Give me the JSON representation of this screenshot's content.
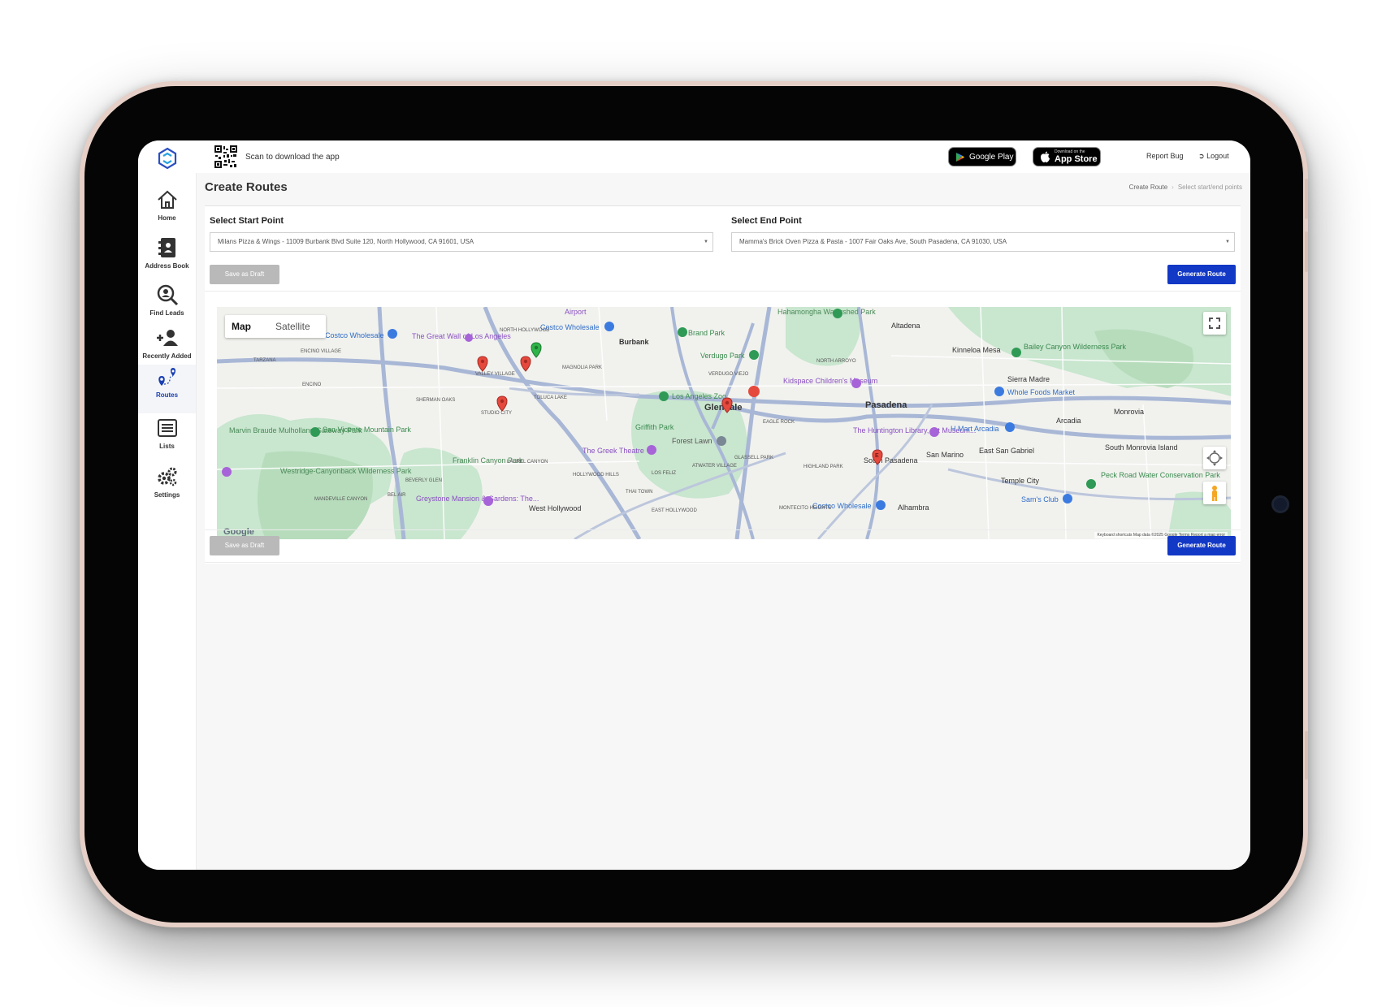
{
  "app": {
    "download": {
      "text": "Scan to download the app"
    },
    "stores": {
      "google_play": "Google Play",
      "app_store_small": "Download on the",
      "app_store": "App Store"
    },
    "top_links": {
      "report_bug": "Report Bug",
      "logout": "Logout"
    }
  },
  "sidebar": {
    "items": [
      {
        "label": "Home",
        "icon": "home-icon"
      },
      {
        "label": "Address Book",
        "icon": "address-book-icon"
      },
      {
        "label": "Find Leads",
        "icon": "search-person-icon"
      },
      {
        "label": "Recently Added",
        "icon": "add-user-icon"
      },
      {
        "label": "Routes",
        "icon": "route-pins-icon",
        "active": true
      },
      {
        "label": "Lists",
        "icon": "list-icon"
      },
      {
        "label": "Settings",
        "icon": "gears-icon"
      }
    ]
  },
  "page": {
    "title": "Create Routes",
    "breadcrumb": [
      "Create Route",
      "Select start/end points"
    ]
  },
  "form": {
    "start_label": "Select Start Point",
    "start_value": "Milans Pizza & Wings - 11009 Burbank Blvd Suite 120, North Hollywood, CA 91601, USA",
    "end_label": "Select End Point",
    "end_value": "Mamma's Brick Oven Pizza & Pasta - 1007 Fair Oaks Ave, South Pasadena, CA 91030, USA",
    "save_draft": "Save as Draft",
    "generate": "Generate Route"
  },
  "map": {
    "type_options": [
      "Map",
      "Satellite"
    ],
    "selected_type": "Map",
    "labels": [
      "Airport",
      "Costco Wholesale",
      "Burbank",
      "Hahamongha Watershed Park",
      "Altadena",
      "Brand Park",
      "Verdugo Park",
      "The Great Wall of Los Angeles",
      "Costco Wholesale",
      "NORTH HOLLYWOOD",
      "ENCINO VILLAGE",
      "TARZANA",
      "VALLEY VILLAGE",
      "MAGNOLIA PARK",
      "VERDUGO VIEJO",
      "NORTH ARROYO",
      "Kinneloa Mesa",
      "Bailey Canyon Wilderness Park",
      "Sierra Madre",
      "Whole Foods Market",
      "ENCINO",
      "SHERMAN OAKS",
      "TOLUCA LAKE",
      "Los Angeles Zoo",
      "Glendale",
      "Kidspace Children's Museum",
      "Pasadena",
      "Arcadia",
      "Monrovia",
      "STUDIO CITY",
      "Griffith Park",
      "EAGLE ROCK",
      "The Huntington Library, Art Museum...",
      "H Mart Arcadia",
      "Marvin Braude Mulholland Gateway Park",
      "San Vicente Mountain Park",
      "Forest Lawn",
      "The Greek Theatre",
      "South Pasadena",
      "San Marino",
      "East San Gabriel",
      "Westridge-Canyonback Wilderness Park",
      "Franklin Canyon Park",
      "LAUREL CANYON",
      "Temple City",
      "Peck Road Water Conservation Park",
      "Greystone Mansion & Gardens: The...",
      "West Hollywood",
      "Costco Wholesale",
      "Alhambra",
      "Sam's Club",
      "BEL AIR",
      "MANDEVILLE CANYON",
      "HOLLYWOOD HILLS",
      "LOS FELIZ",
      "THAI TOWN",
      "EAST HOLLYWOOD",
      "ATWATER VILLAGE",
      "GLASSELL PARK",
      "HIGHLAND PARK",
      "MONTECITO HEIGHTS",
      "South Monrovia Island",
      "BEVERLY GLEN"
    ],
    "footer": "Keyboard shortcuts   Map data ©2025 Google   Terms   Report a map error",
    "google_logo": "Google",
    "marker_end_letter": "E"
  }
}
